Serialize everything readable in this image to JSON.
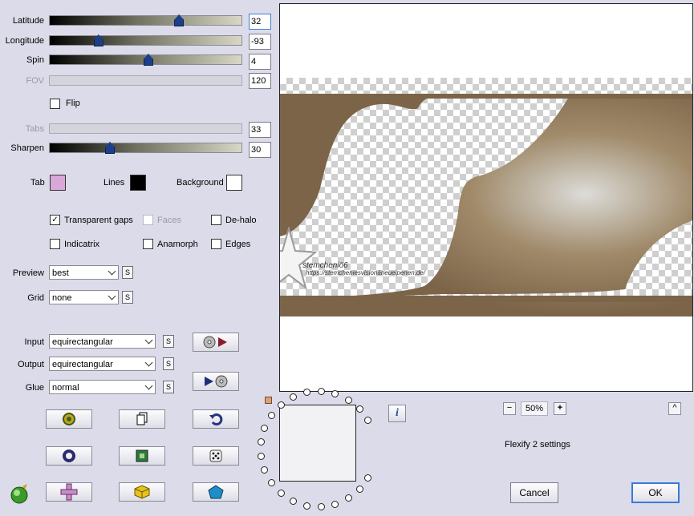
{
  "sliders": {
    "latitude": {
      "label": "Latitude",
      "value": "32",
      "fraction": 0.67,
      "enabled": true
    },
    "longitude": {
      "label": "Longitude",
      "value": "-93",
      "fraction": 0.25,
      "enabled": true
    },
    "spin": {
      "label": "Spin",
      "value": "4",
      "fraction": 0.51,
      "enabled": true
    },
    "fov": {
      "label": "FOV",
      "value": "120",
      "enabled": false
    },
    "tabs": {
      "label": "Tabs",
      "value": "33",
      "enabled": false
    },
    "sharpen": {
      "label": "Sharpen",
      "value": "30",
      "fraction": 0.31,
      "enabled": true
    }
  },
  "flip": {
    "label": "Flip",
    "checked": false
  },
  "colors": {
    "tab": {
      "label": "Tab",
      "color": "#d9a8d9"
    },
    "lines": {
      "label": "Lines",
      "color": "#000000"
    },
    "background": {
      "label": "Background",
      "color": "#ffffff"
    }
  },
  "options": {
    "transparent_gaps": {
      "label": "Transparent gaps",
      "checked": true
    },
    "faces": {
      "label": "Faces",
      "checked": false,
      "enabled": false
    },
    "de_halo": {
      "label": "De-halo",
      "checked": false
    },
    "indicatrix": {
      "label": "Indicatrix",
      "checked": false
    },
    "anamorph": {
      "label": "Anamorph",
      "checked": false
    },
    "edges": {
      "label": "Edges",
      "checked": false
    }
  },
  "selects": {
    "preview": {
      "label": "Preview",
      "value": "best"
    },
    "grid": {
      "label": "Grid",
      "value": "none"
    },
    "input": {
      "label": "Input",
      "value": "equirectangular"
    },
    "output": {
      "label": "Output",
      "value": "equirectangular"
    },
    "glue": {
      "label": "Glue",
      "value": "normal"
    }
  },
  "s_label": "S",
  "info_label": "i",
  "zoom": {
    "minus": "−",
    "value": "50%",
    "plus": "+"
  },
  "collapse_label": "^",
  "settings_title": "Flexify 2 settings",
  "watermark": {
    "text": "stemcheniö6",
    "url": "https://stemcheniesvisionärieuelpenen.de/"
  },
  "buttons": {
    "cancel": "Cancel",
    "ok": "OK"
  },
  "ui_colors": {
    "accent": "#3a7bd5",
    "panel": "#dcdbe9",
    "image_brown": "#7b6448"
  }
}
